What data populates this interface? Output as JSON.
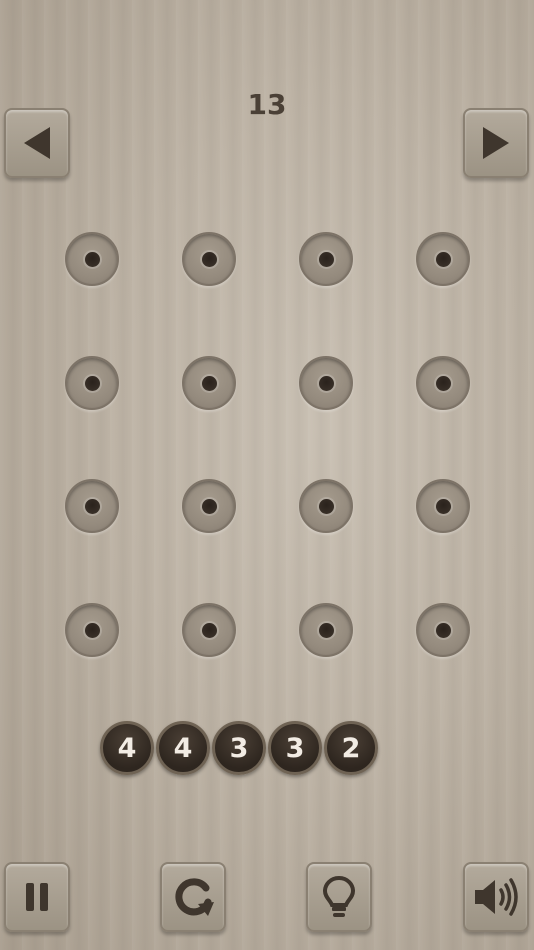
{
  "level": {
    "number": "13"
  },
  "nav": {
    "prev_icon": "triangle-left-icon",
    "next_icon": "triangle-right-icon"
  },
  "board": {
    "rows": 4,
    "cols": 4,
    "pegs": 16
  },
  "pieces": [
    {
      "value": "4"
    },
    {
      "value": "4"
    },
    {
      "value": "3"
    },
    {
      "value": "3"
    },
    {
      "value": "2"
    }
  ],
  "toolbar": {
    "pause_icon": "pause-icon",
    "restart_icon": "restart-icon",
    "hint_icon": "lightbulb-icon",
    "sound_icon": "speaker-icon"
  },
  "colors": {
    "board": "#bdb3a5",
    "button": "#a89f91",
    "icon": "#4a4036",
    "piece": "#2e261f",
    "piece_text": "#f2ece4"
  }
}
